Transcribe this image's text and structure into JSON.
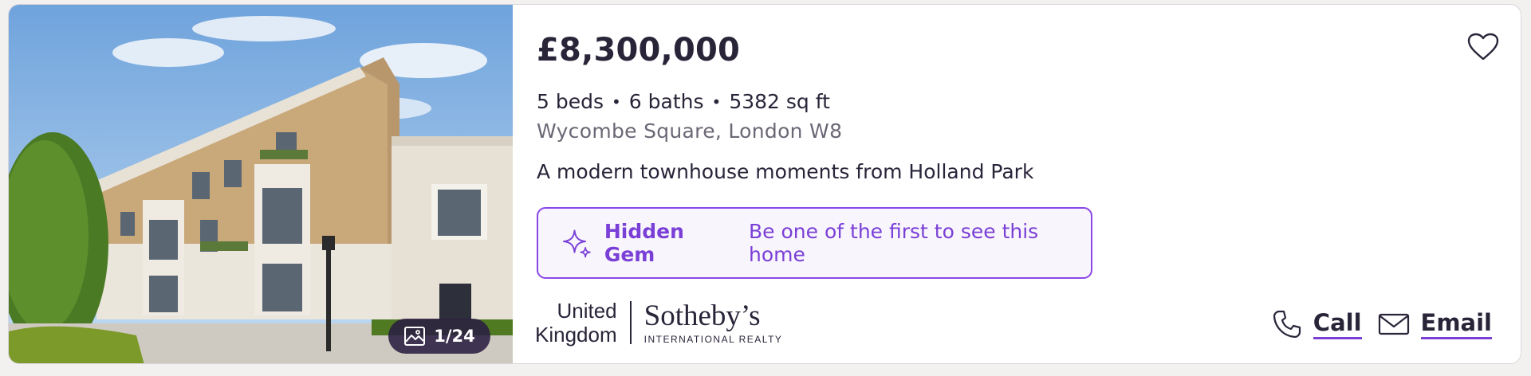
{
  "listing": {
    "price": "£8,300,000",
    "beds": "5 beds",
    "baths": "6 baths",
    "area": "5382 sq ft",
    "separator": "•",
    "address": "Wycombe Square, London W8",
    "headline": "A modern townhouse moments from Holland Park"
  },
  "photo": {
    "counter": "1/24",
    "alt_icon": "image-icon"
  },
  "badge": {
    "title": "Hidden Gem",
    "text": "Be one of the first to see this home",
    "icon": "sparkle-icon",
    "accent": "#7a3fd6"
  },
  "agent": {
    "region_line1": "United",
    "region_line2": "Kingdom",
    "brand": "Sotheby’s",
    "sub": "INTERNATIONAL REALTY"
  },
  "actions": {
    "call_label": "Call",
    "email_label": "Email",
    "call_icon": "phone-icon",
    "email_icon": "mail-icon",
    "favorite_icon": "heart-icon"
  }
}
